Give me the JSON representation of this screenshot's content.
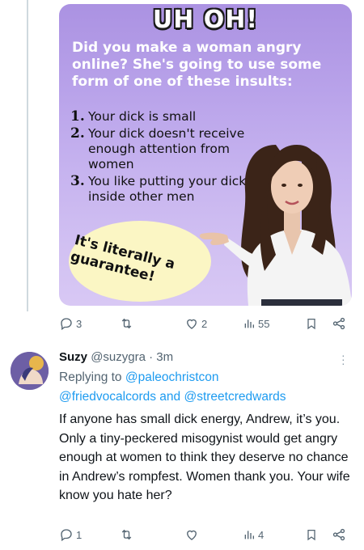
{
  "tweet": {
    "meme": {
      "header": "UH OH!",
      "intro": "Did you make a woman angry online? She's going to use some form of one of these insults:",
      "items": [
        {
          "num": "1.",
          "text": "Your dick is small"
        },
        {
          "num": "2.",
          "text": "Your dick doesn't receive enough attention from women"
        },
        {
          "num": "3.",
          "text": "You like putting your dick inside other men"
        }
      ],
      "bubble": "It's literally a guarantee!"
    },
    "actions": {
      "replies": "3",
      "retweets": "",
      "likes": "2",
      "views": "55"
    }
  },
  "reply": {
    "name": "Suzy",
    "handle": "@suzygra",
    "separator": "·",
    "time": "3m",
    "replying_prefix": "Replying to",
    "replying_handles": [
      "@paleochristcon",
      "@friedvocalcords",
      "@streetcredwards"
    ],
    "replying_and": "and",
    "body": "If anyone has small dick energy, Andrew, it’s you. Only a tiny-peckered misogynist would get angry enough at women to think they deserve no chance in Andrew’s rompfest. Women thank you. Your wife know you hate her?",
    "actions": {
      "replies": "1",
      "retweets": "",
      "likes": "",
      "views": "4"
    }
  },
  "colors": {
    "link": "#1d9bf0",
    "muted": "#536471",
    "meme_bg": "#b9a3ea",
    "bubble": "#fbf6c4"
  }
}
